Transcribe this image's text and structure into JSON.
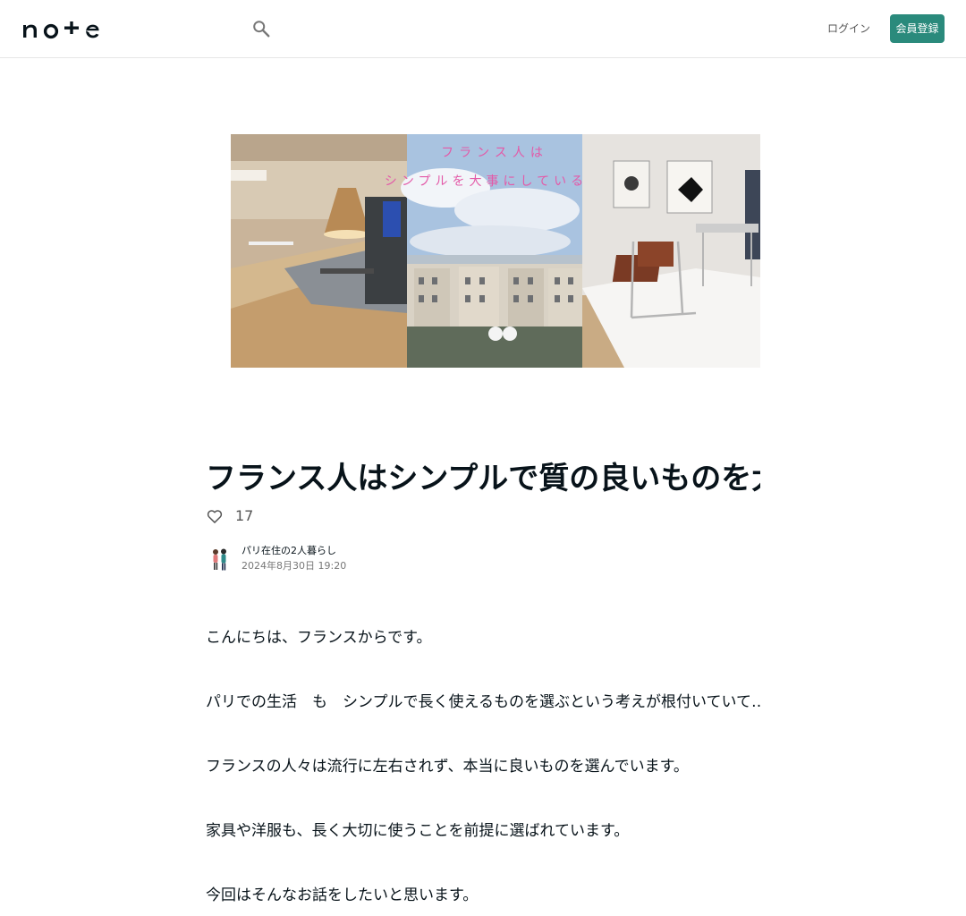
{
  "header": {
    "logo_text": "note",
    "search_icon": "search-icon",
    "login_label": "ログイン",
    "signup_label": "会員登録",
    "accent_color": "#2a8a7c"
  },
  "hero": {
    "overlay_line1": "フランス人は",
    "overlay_line2": "シンプルを大事にしている。",
    "overlay_color": "#e35aa8"
  },
  "article": {
    "title": "フランス人はシンプルで質の良いものを大事にしている。という話",
    "like_icon": "heart-icon",
    "likes": "17",
    "author_name": "パリ在住の2人暮らし",
    "date": "2024年8月30日 19:20",
    "paragraphs": [
      "こんにちは、フランスからです。",
      "パリでの生活　も　シンプルで長く使えるものを選ぶという考えが根付いていて…",
      "フランスの人々は流行に左右されず、本当に良いものを選んでいます。",
      "家具や洋服も、長く大切に使うことを前提に選ばれています。",
      "今回はそんなお話をしたいと思います。"
    ]
  }
}
